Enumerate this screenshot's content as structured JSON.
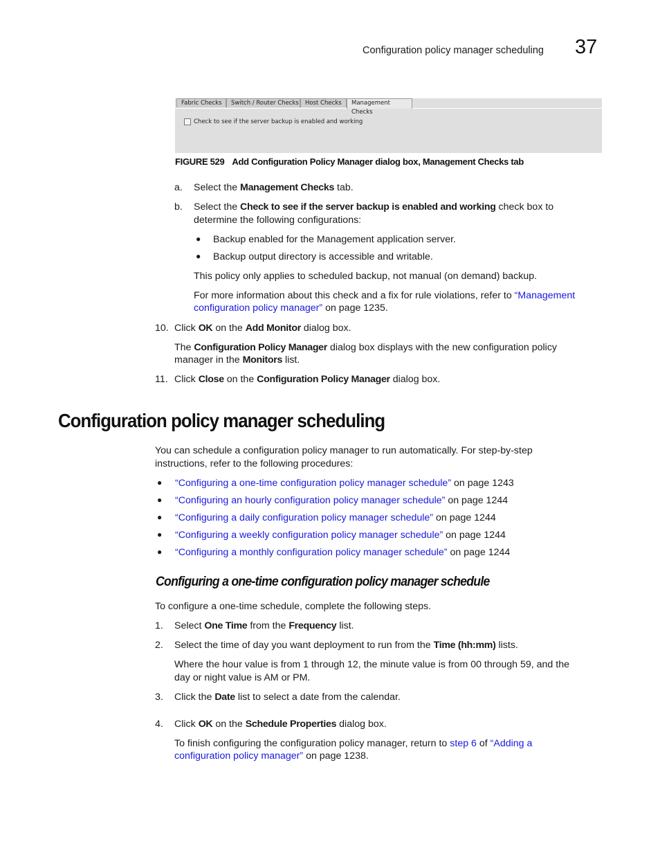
{
  "header": {
    "running_title": "Configuration policy manager scheduling",
    "chapter_number": "37"
  },
  "figure": {
    "tabs": [
      {
        "label": "Fabric Checks",
        "active": false
      },
      {
        "label": "Switch / Router Checks",
        "active": false
      },
      {
        "label": "Host Checks",
        "active": false
      },
      {
        "label": "Management Checks",
        "active": true
      }
    ],
    "checkbox_label": "Check to see if the server backup is enabled and working",
    "checkbox_checked": false,
    "caption_number": "FIGURE 529",
    "caption_text": "Add Configuration Policy Manager dialog box, Management Checks tab"
  },
  "steps_top": {
    "a": {
      "marker": "a.",
      "pre": "Select the ",
      "bold": "Management Checks",
      "post": " tab."
    },
    "b": {
      "marker": "b.",
      "pre": "Select the ",
      "bold": "Check to see if the server backup is enabled and working",
      "post": " check box to",
      "line2": "determine the following configurations:"
    },
    "bullets": [
      "Backup enabled for the Management application server.",
      "Backup output directory is accessible and writable."
    ],
    "note": "This policy only applies to scheduled backup, not manual (on demand) backup.",
    "more_info": {
      "pre": "For more information about this check and a fix for rule violations, refer to ",
      "link_part1": "“Management",
      "link_part2": "configuration policy manager”",
      "post": " on page 1235."
    },
    "step10": {
      "marker": "10.",
      "t1": "Click ",
      "b1": "OK",
      "t2": " on the ",
      "b2": "Add Monitor",
      "t3": " dialog box.",
      "desc_t1": "The ",
      "desc_b1": "Configuration Policy Manager",
      "desc_t2": " dialog box displays with the new configuration policy",
      "desc_line2_t1": "manager in the ",
      "desc_line2_b1": "Monitors",
      "desc_line2_t2": " list."
    },
    "step11": {
      "marker": "11.",
      "t1": "Click ",
      "b1": "Close",
      "t2": " on the ",
      "b2": "Configuration Policy Manager",
      "t3": " dialog box."
    }
  },
  "section": {
    "title": "Configuration policy manager scheduling",
    "intro_line1": "You can schedule a configuration policy manager to run automatically. For step-by-step",
    "intro_line2": "instructions, refer to the following procedures:",
    "links": [
      {
        "link": "“Configuring a one-time configuration policy manager schedule”",
        "page": " on page 1243"
      },
      {
        "link": "“Configuring an hourly configuration policy manager schedule”",
        "page": " on page 1244"
      },
      {
        "link": "“Configuring a daily configuration policy manager schedule”",
        "page": " on page 1244"
      },
      {
        "link": "“Configuring a weekly configuration policy manager schedule”",
        "page": " on page 1244"
      },
      {
        "link": "“Configuring a monthly configuration policy manager schedule”",
        "page": " on page 1244"
      }
    ]
  },
  "subsection": {
    "title": "Configuring a one-time configuration policy manager schedule",
    "intro": "To configure a one-time schedule, complete the following steps.",
    "step1": {
      "marker": "1.",
      "t1": "Select ",
      "b1": "One Time",
      "t2": " from the ",
      "b2": "Frequency",
      "t3": " list."
    },
    "step2": {
      "marker": "2.",
      "t1": "Select the time of day you want deployment to run from the ",
      "b1": "Time (hh:mm)",
      "t2": " lists.",
      "desc_line1": "Where the hour value is from 1 through 12, the minute value is from 00 through 59, and the",
      "desc_line2": "day or night value is AM or PM."
    },
    "step3": {
      "marker": "3.",
      "t1": "Click the ",
      "b1": "Date",
      "t2": " list to select a date from the calendar."
    },
    "step4": {
      "marker": "4.",
      "t1": "Click ",
      "b1": "OK",
      "t2": " on the ",
      "b2": "Schedule Properties",
      "t3": " dialog box.",
      "desc_t1": "To finish configuring the configuration policy manager, return to ",
      "desc_link1": "step 6",
      "desc_t2": " of ",
      "desc_link2a": "“Adding a",
      "desc_link2b": "configuration policy manager”",
      "desc_t3": " on page 1238."
    }
  }
}
